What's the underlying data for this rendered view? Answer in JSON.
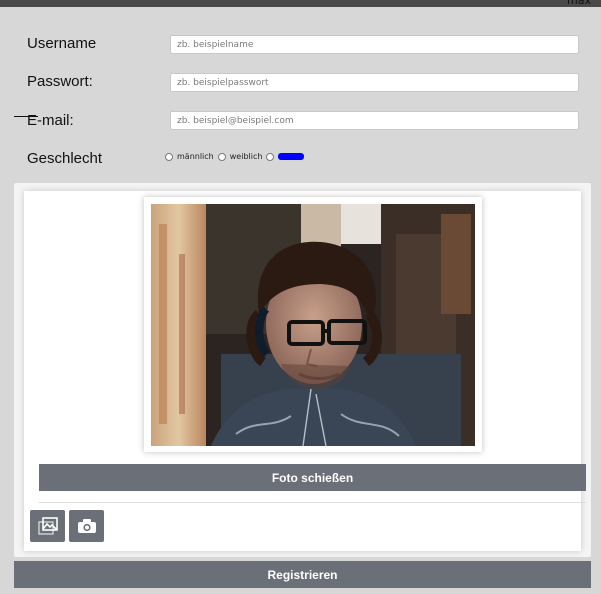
{
  "header": {
    "corner_label": "max"
  },
  "form": {
    "username_label": "Username",
    "username_placeholder": "zb. beispielname",
    "password_label": "Passwort:",
    "password_placeholder": "zb. beispielpasswort",
    "email_label": "E-mail:",
    "email_placeholder": "zb. beispiel@beispiel.com",
    "gender_label": "Geschlecht",
    "gender_options": [
      "männlich",
      "weiblich"
    ]
  },
  "camera": {
    "take_photo_label": "Foto schießen",
    "tools": [
      {
        "icon": "gallery-icon"
      },
      {
        "icon": "camera-icon"
      }
    ]
  },
  "register_label": "Registrieren",
  "colors": {
    "button": "#6b6f77",
    "custom_option": "#0000ff",
    "background": "#d7d7d7"
  }
}
